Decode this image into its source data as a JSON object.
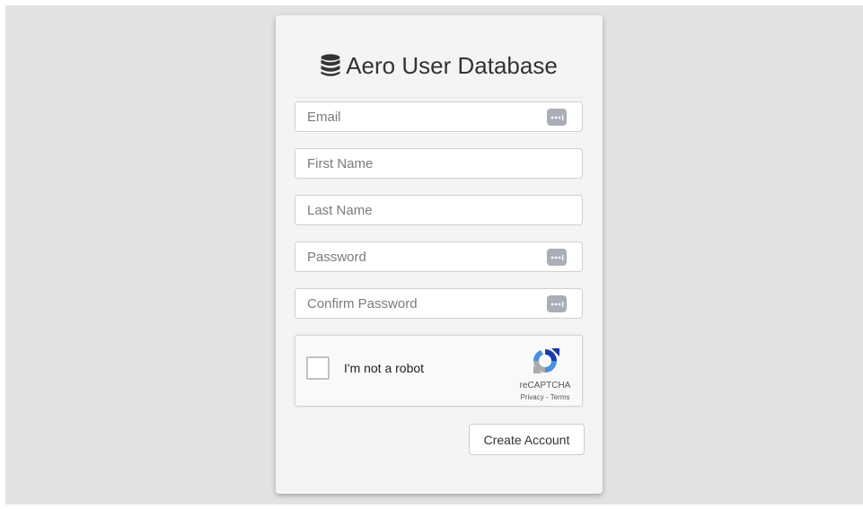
{
  "header": {
    "title": "Aero User Database",
    "icon": "database-icon"
  },
  "form": {
    "email": {
      "placeholder": "Email",
      "value": "",
      "has_password_manager_icon": true
    },
    "first_name": {
      "placeholder": "First Name",
      "value": ""
    },
    "last_name": {
      "placeholder": "Last Name",
      "value": ""
    },
    "password": {
      "placeholder": "Password",
      "value": "",
      "has_password_manager_icon": true
    },
    "confirm_password": {
      "placeholder": "Confirm Password",
      "value": "",
      "has_password_manager_icon": true
    },
    "submit_label": "Create Account"
  },
  "captcha": {
    "checkbox_label": "I'm not a robot",
    "checked": false,
    "brand": "reCAPTCHA",
    "links": "Privacy - Terms"
  },
  "colors": {
    "page_background": "#e2e2e2",
    "card_background": "#f4f4f4",
    "icon_gray": "#a9aeb8",
    "captcha_blue": "#4a90e2"
  }
}
